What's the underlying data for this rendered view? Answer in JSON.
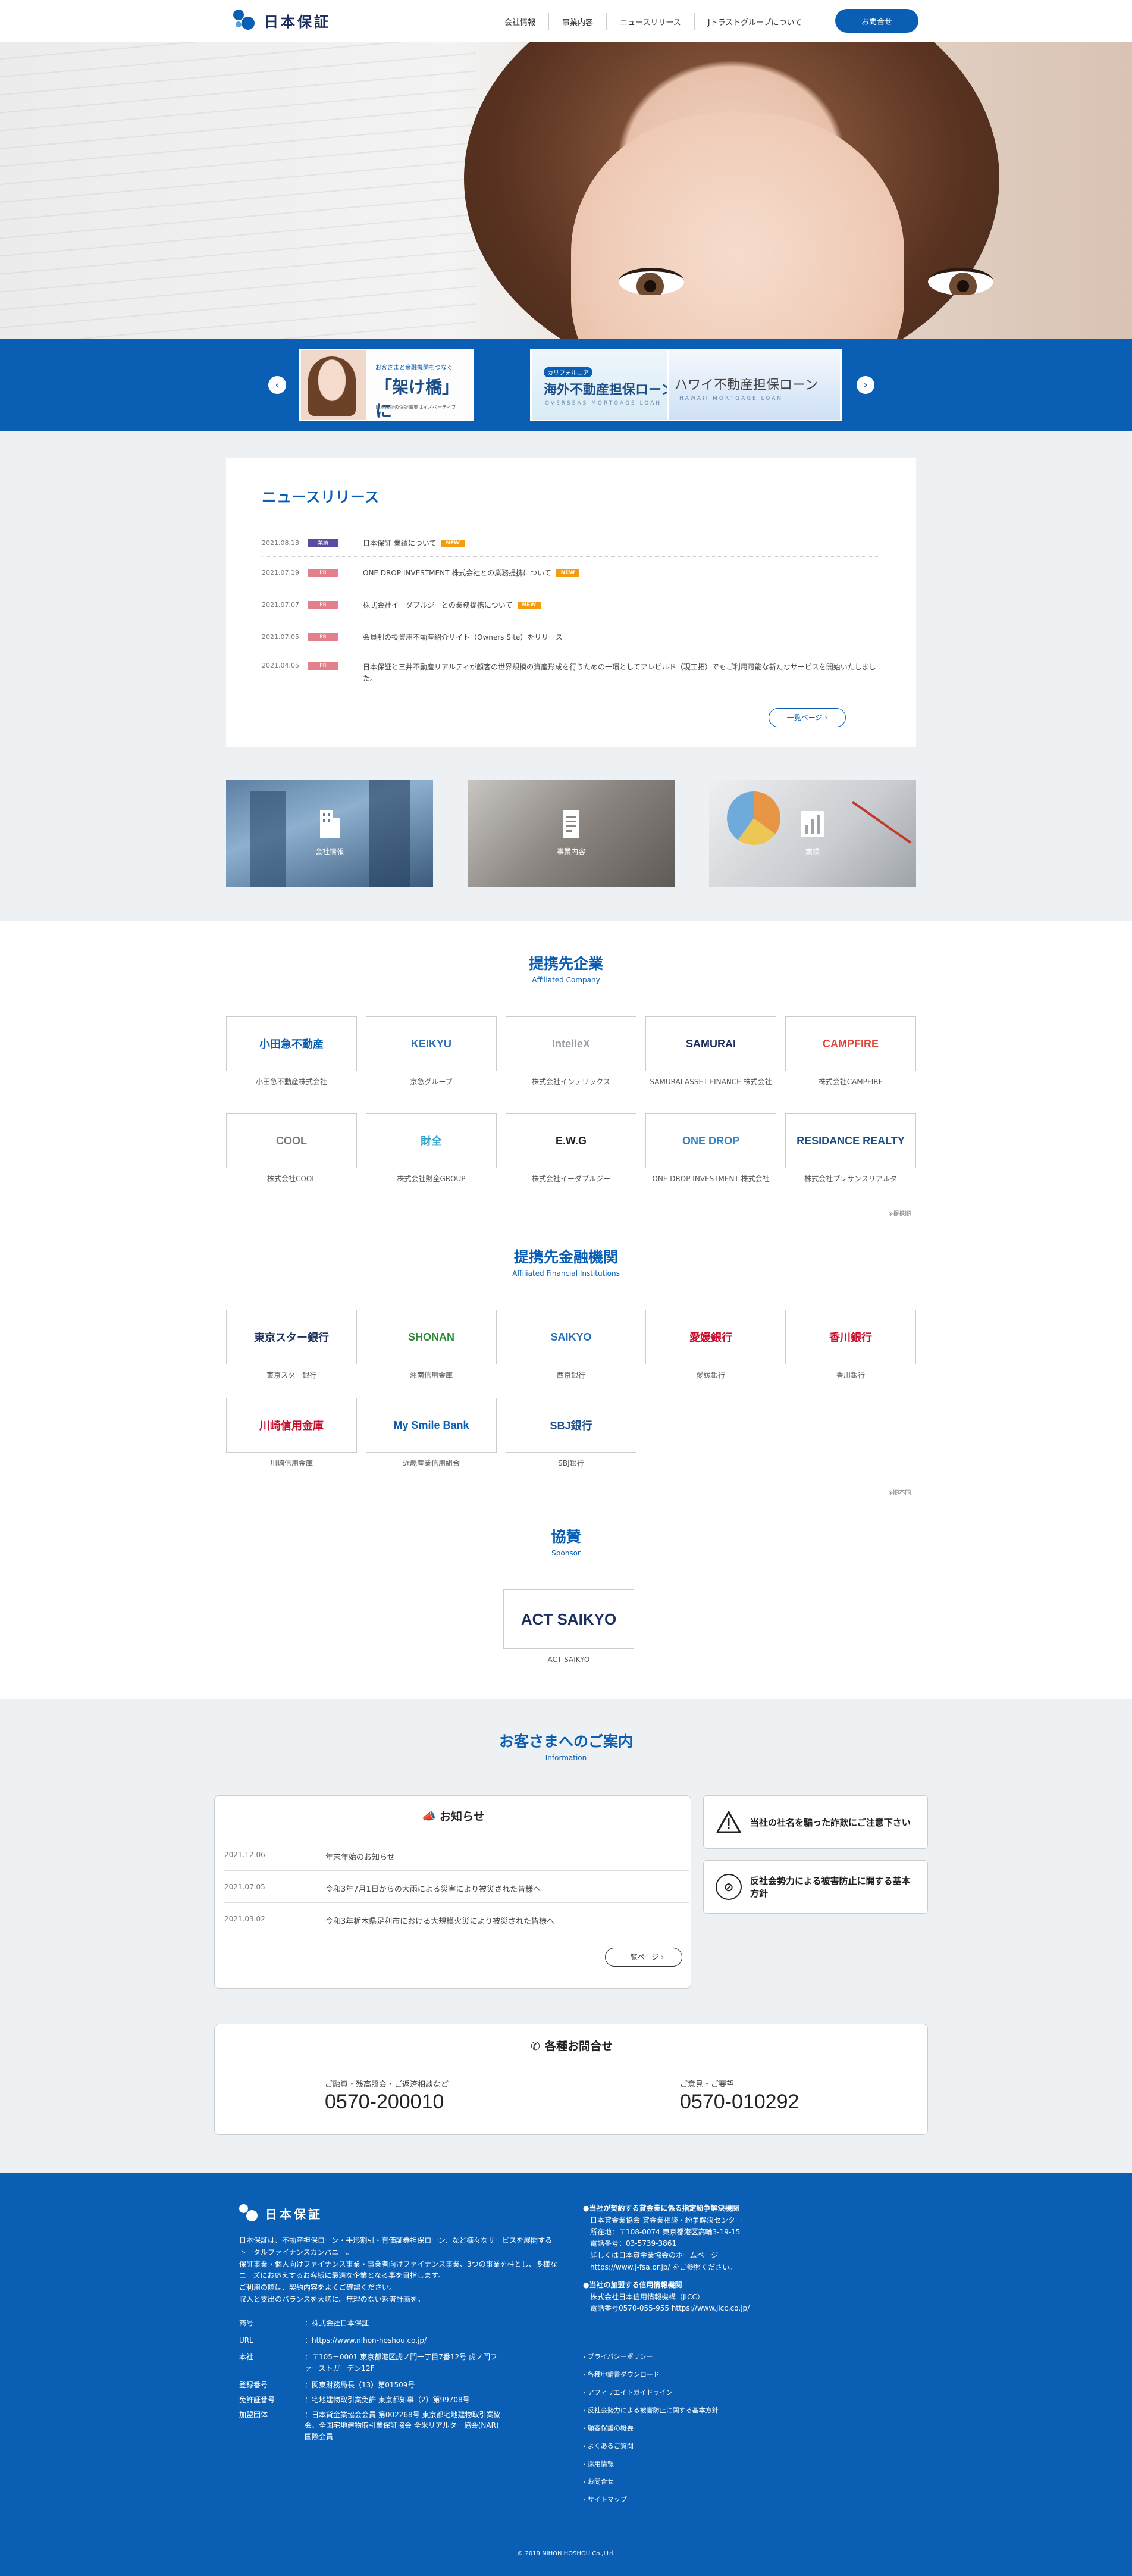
{
  "header": {
    "logo_text": "日本保証",
    "nav": [
      "会社情報",
      "事業内容",
      "ニュースリリース",
      "Jトラストグループについて"
    ],
    "contact_button": "お問合せ"
  },
  "banners": [
    {
      "sub": "お客さまと金融機関をつなぐ",
      "main": "「架け橋」に",
      "en": "日本保証の保証事業はイノベーティブ"
    },
    {
      "sub": "カリフォルニア",
      "main": "海外不動産担保ローン",
      "en": "OVERSEAS MORTGAGE LOAN"
    },
    {
      "sub": "",
      "main": "ハワイ不動産担保ローン",
      "en": "HAWAII MORTGAGE LOAN"
    }
  ],
  "news": {
    "title": "ニュースリリース",
    "items": [
      {
        "date": "2021.08.13",
        "tag": "業績",
        "tag_color": "#5b4aa0",
        "text": "日本保証 業績について",
        "is_new": true
      },
      {
        "date": "2021.07.19",
        "tag": "PR",
        "tag_color": "#e47f8c",
        "text": "ONE DROP INVESTMENT 株式会社との業務提携について",
        "is_new": true
      },
      {
        "date": "2021.07.07",
        "tag": "PR",
        "tag_color": "#e47f8c",
        "text": "株式会社イーダブルジーとの業務提携について",
        "is_new": true
      },
      {
        "date": "2021.07.05",
        "tag": "PR",
        "tag_color": "#e47f8c",
        "text": "会員制の投資用不動産紹介サイト（Owners Site）をリリース",
        "is_new": false
      },
      {
        "date": "2021.04.05",
        "tag": "PR",
        "tag_color": "#e47f8c",
        "text": "日本保証と三井不動産リアルティが顧客の世界規模の資産形成を行うための一環としてアレビルド（現工拓）でもご利用可能な新たなサービスを開始いたしました。",
        "is_new": false
      }
    ],
    "more": "一覧ページ",
    "new_label": "NEW"
  },
  "cards": [
    {
      "label": "会社情報",
      "icon": "building-icon"
    },
    {
      "label": "事業内容",
      "icon": "document-icon"
    },
    {
      "label": "業績",
      "icon": "bar-chart-icon"
    }
  ],
  "affiliated": {
    "title": "提携先企業",
    "subtitle": "Affiliated Company",
    "note": "※提携順",
    "items": [
      {
        "logo": "小田急不動産",
        "name": "小田急不動産株式会社",
        "color": "#0a5fb4"
      },
      {
        "logo": "KEIKYU",
        "name": "京急グループ",
        "color": "#2a6fb8"
      },
      {
        "logo": "IntelleX",
        "name": "株式会社インテリックス",
        "color": "#9aa0a6"
      },
      {
        "logo": "SAMURAI",
        "name": "SAMURAI ASSET FINANCE 株式会社",
        "color": "#1c2f5e"
      },
      {
        "logo": "CAMPFIRE",
        "name": "株式会社CAMPFIRE",
        "color": "#e0453a"
      },
      {
        "logo": "COOL",
        "name": "株式会社COOL",
        "color": "#777777"
      },
      {
        "logo": "財全",
        "name": "株式会社財全GROUP",
        "color": "#2aa0c8"
      },
      {
        "logo": "E.W.G",
        "name": "株式会社イーダブルジー",
        "color": "#222222"
      },
      {
        "logo": "ONE DROP",
        "name": "ONE DROP INVESTMENT 株式会社",
        "color": "#2a7fc8"
      },
      {
        "logo": "RESIDANCE REALTY",
        "name": "株式会社プレサンスリアルタ",
        "color": "#1c4f8a"
      }
    ]
  },
  "financial": {
    "title": "提携先金融機関",
    "subtitle": "Affiliated Financial Institutions",
    "note": "※順不同",
    "items": [
      {
        "logo": "東京スター銀行",
        "name": "東京スター銀行",
        "color": "#1c2f5e"
      },
      {
        "logo": "SHONAN",
        "name": "湘南信用金庫",
        "color": "#2a8a3a"
      },
      {
        "logo": "SAIKYO",
        "name": "西京銀行",
        "color": "#2a6fb8"
      },
      {
        "logo": "愛媛銀行",
        "name": "愛媛銀行",
        "color": "#c8102e"
      },
      {
        "logo": "香川銀行",
        "name": "香川銀行",
        "color": "#c8102e"
      },
      {
        "logo": "川崎信用金庫",
        "name": "川崎信用金庫",
        "color": "#c8102e"
      },
      {
        "logo": "My Smile Bank",
        "name": "近畿産業信用組合",
        "color": "#0a5fb4"
      },
      {
        "logo": "SBJ銀行",
        "name": "SBJ銀行",
        "color": "#1c4f8a"
      }
    ]
  },
  "sponsor": {
    "title": "協賛",
    "subtitle": "Sponsor",
    "logo": "ACT SAIKYO",
    "name": "ACT SAIKYO"
  },
  "information": {
    "title": "お客さまへのご案内",
    "subtitle": "Information",
    "notice_title": "お知らせ",
    "notices": [
      {
        "date": "2021.12.06",
        "text": "年末年始のお知らせ"
      },
      {
        "date": "2021.07.05",
        "text": "令和3年7月1日からの大雨による災害により被災された皆様へ"
      },
      {
        "date": "2021.03.02",
        "text": "令和3年栃木県足利市における大規模火災により被災された皆様へ"
      }
    ],
    "more": "一覧ページ",
    "side_links": [
      {
        "icon": "warning-icon",
        "text": "当社の社名を騙った詐欺にご注意下さい"
      },
      {
        "icon": "no-entry-icon",
        "text": "反社会勢力による被害防止に関する基本方針"
      }
    ],
    "contact_title": "各種お問合せ",
    "contacts": [
      {
        "label": "ご融資・残高照会・ご返済相談など",
        "number": "0570-200010"
      },
      {
        "label": "ご意見・ご要望",
        "number": "0570-010292"
      }
    ]
  },
  "footer": {
    "logo_text": "日本保証",
    "about": [
      "日本保証は、不動産担保ローン・手形割引・有価証券担保ローン、など様々なサービスを展開するトータルファイナンスカンパニー。",
      "保証事業・個人向けファイナンス事業・事業者向けファイナンス事業、3つの事業を柱とし、多様なニーズにお応えするお客様に最適な企業となる事を目指します。",
      "ご利用の際は、契約内容をよくご確認ください。",
      "収入と支出のバランスを大切に。無理のない返済計画を。"
    ],
    "table": [
      {
        "k": "商号",
        "v": "：株式会社日本保証"
      },
      {
        "k": "URL",
        "v": "：https://www.nihon-hoshou.co.jp/"
      },
      {
        "k": "本社",
        "v": "：〒105－0001 東京都港区虎ノ門一丁目7番12号 虎ノ門ファーストガーデン12F"
      },
      {
        "k": "登録番号",
        "v": "：関東財務局長（13）第01509号"
      },
      {
        "k": "免許証番号",
        "v": "：宅地建物取引業免許 東京都知事（2）第99708号"
      },
      {
        "k": "加盟団体",
        "v": "：日本貸金業協会会員 第002268号 東京都宅地建物取引業協会、全国宅地建物取引業保証協会 全米リアルター協会(NAR)国際会員"
      }
    ],
    "adr_title": "●当社が契約する貸金業に係る指定紛争解決機関",
    "adr_lines": [
      "日本貸金業協会 貸金業相談・紛争解決センター",
      "所在地：〒108-0074 東京都港区高輪3-19-15",
      "電話番号：03-5739-3861",
      "詳しくは日本貸金業協会のホームページ",
      "https://www.j-fsa.or.jp/ をご参照ください。"
    ],
    "jicc_title": "●当社の加盟する信用情報機関",
    "jicc_lines": [
      "株式会社日本信用情報機構（JICC）",
      "電話番号0570-055-955 https://www.jicc.co.jp/"
    ],
    "links": [
      "プライバシーポリシー",
      "各種申請書ダウンロード",
      "アフィリエイトガイドライン",
      "反社会勢力による被害防止に関する基本方針",
      "顧客保護の概要",
      "よくあるご質問",
      "採用情報",
      "お問合せ",
      "サイトマップ"
    ],
    "copyright": "© 2019 NIHON HOSHOU Co.,Ltd."
  }
}
